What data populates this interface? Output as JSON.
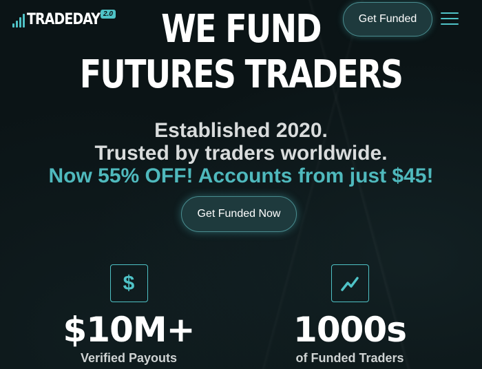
{
  "brand": {
    "name": "TRADEDAY",
    "version_badge": "2.0"
  },
  "nav": {
    "cta_label": "Get Funded"
  },
  "hero": {
    "headline_line1": "WE FUND",
    "headline_line2": "FUTURES TRADERS",
    "sub_line1": "Established 2020.",
    "sub_line2": "Trusted by traders worldwide.",
    "promo": "Now 55% OFF! Accounts from just $45!",
    "cta_label": "Get Funded Now"
  },
  "stats": [
    {
      "icon": "dollar-icon",
      "icon_glyph": "$",
      "value": "$10M+",
      "label": "Verified Payouts"
    },
    {
      "icon": "trend-up-icon",
      "value": "1000s",
      "label": "of Funded Traders"
    }
  ],
  "colors": {
    "background": "#0b1416",
    "accent": "#4fc3c7",
    "button_bg": "#1e3a3d"
  }
}
